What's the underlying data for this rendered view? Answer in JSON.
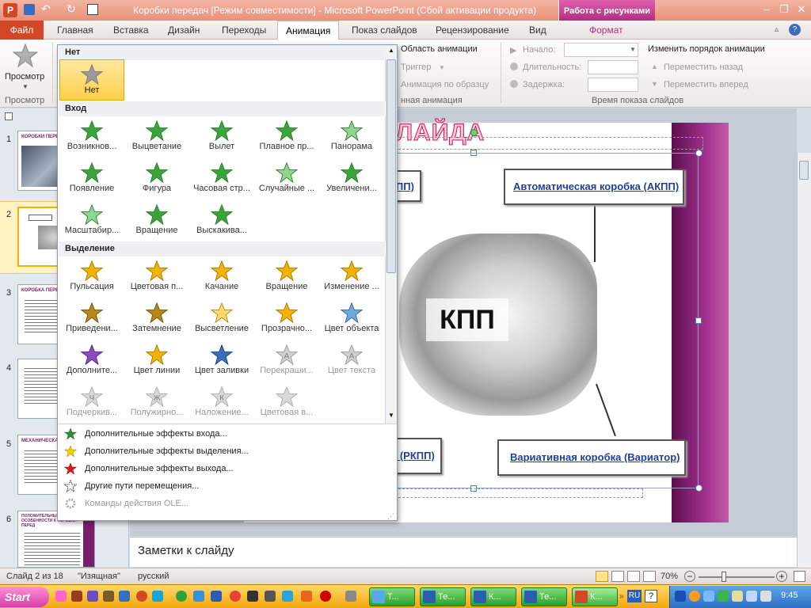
{
  "window": {
    "title": "Коробки передач [Режим совместимости]  -  Microsoft PowerPoint (Сбой активации продукта)",
    "context_tab": "Работа с рисунками",
    "controls": [
      "–",
      "❐",
      "✕"
    ]
  },
  "tabs": [
    {
      "label": "Файл"
    },
    {
      "label": "Главная"
    },
    {
      "label": "Вставка"
    },
    {
      "label": "Дизайн"
    },
    {
      "label": "Переходы"
    },
    {
      "label": "Анимация"
    },
    {
      "label": "Показ слайдов"
    },
    {
      "label": "Рецензирование"
    },
    {
      "label": "Вид"
    },
    {
      "label": "Формат"
    }
  ],
  "ribbon": {
    "preview_label": "Просмотр",
    "preview_group": "Просмотр",
    "anim_pane": "Область анимации",
    "trigger": "Триггер",
    "anim_painter": "Анимация по образцу",
    "ext_group_partial": "нная анимация",
    "start_label": "Начало:",
    "duration_label": "Длительность:",
    "delay_label": "Задержка:",
    "timing_group": "Время показа слайдов",
    "reorder_title": "Изменить порядок анимации",
    "move_back": "Переместить назад",
    "move_forward": "Переместить вперед"
  },
  "gallery": {
    "sections": {
      "none": "Нет",
      "entrance": "Вход",
      "emphasis": "Выделение"
    },
    "none_item": "Нет",
    "entrance_items": [
      "Возникнов...",
      "Выцветание",
      "Вылет",
      "Плавное пр...",
      "Панорама",
      "Появление",
      "Фигура",
      "Часовая стр...",
      "Случайные ...",
      "Увеличени...",
      "Масштабир...",
      "Вращение",
      "Выскакива..."
    ],
    "emphasis_items": [
      "Пульсация",
      "Цветовая п...",
      "Качание",
      "Вращение",
      "Изменение ...",
      "Приведени...",
      "Затемнение",
      "Высветление",
      "Прозрачно...",
      "Цвет объекта",
      "Дополните...",
      "Цвет линии",
      "Цвет заливки",
      "Перекраши...",
      "Цвет текста",
      "Подчеркив...",
      "Полужирно...",
      "Наложение...",
      "Цветовая в..."
    ],
    "emphasis_letters": [
      "Ч",
      "Ж",
      "К"
    ],
    "menu": [
      "Дополнительные эффекты входа...",
      "Дополнительные эффекты выделения...",
      "Дополнительные эффекты выхода...",
      "Другие пути перемещения...",
      "Команды действия OLE..."
    ]
  },
  "slide": {
    "title_fragment": "ЛАЙДА",
    "box_top_left": "КПП)",
    "box_top_right": "Автоматическая коробка (АКПП)",
    "box_bottom_left": "а (РКПП)",
    "box_bottom_right": "Вариативная коробка (Вариатор)",
    "center_label": "КПП"
  },
  "thumbnails": {
    "numbers": [
      "1",
      "2",
      "3",
      "4",
      "5",
      "6"
    ],
    "t1_title": "КОРОБКИ ПЕРЕД",
    "t3_title": "КОРОБКА ПЕРЕД",
    "t5_title": "МЕХАНИЧЕСКА",
    "t6_title": "ПОЛОЖИТЕЛЬНЫ ОСОБЕННОСТИ К КОРОБКИ ПЕРЕД"
  },
  "notes_placeholder": "Заметки к слайду",
  "status": {
    "slide_info": "Слайд 2 из 18",
    "theme": "\"Изящная\"",
    "language": "русский",
    "zoom": "70%"
  },
  "taskbar": {
    "start": "Start",
    "buttons": [
      "Т...",
      "Те...",
      "К...",
      "Те...",
      "К..."
    ],
    "lang": "RU",
    "time": "9:45"
  },
  "colors": {
    "accent_red": "#d24726",
    "pic_tools": "#b0307f",
    "slide_purple": "#7a1d6b",
    "star_green": "#3aa63a",
    "star_gold": "#f2b300"
  }
}
